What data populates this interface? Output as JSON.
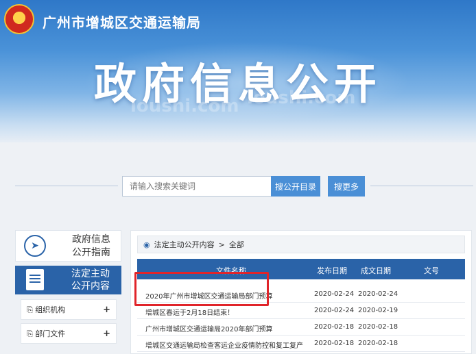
{
  "header": {
    "org_name": "广州市增城区交通运输局",
    "title": "政府信息公开",
    "watermark": "loushi.com"
  },
  "search": {
    "placeholder": "请输入搜索关键词",
    "catalog_button": "搜公开目录",
    "more_button": "搜更多"
  },
  "sidebar": {
    "guide_label_1": "政府信息",
    "guide_label_2": "公开指南",
    "active_label_1": "法定主动",
    "active_label_2": "公开内容",
    "items": [
      {
        "label": "组织机构",
        "plus": "+"
      },
      {
        "label": "部门文件",
        "plus": "+"
      }
    ]
  },
  "breadcrumb": {
    "section": "法定主动公开内容",
    "separator": ">",
    "current": "全部"
  },
  "table": {
    "columns": [
      "文件名称",
      "发布日期",
      "成文日期",
      "文号"
    ],
    "rows": [
      {
        "title": "2020年广州市增城区交通运输局部门预算",
        "published": "2020-02-24",
        "created": "2020-02-24"
      },
      {
        "title": "增城区春运于2月18日结束！",
        "published": "2020-02-24",
        "created": "2020-02-19"
      },
      {
        "title": "广州市增城区交通运输局2020年部门预算",
        "published": "2020-02-18",
        "created": "2020-02-18"
      },
      {
        "title": "增城区交通运输局检查客运企业疫情防控和复工复产",
        "published": "2020-02-18",
        "created": "2020-02-18"
      }
    ]
  },
  "colors": {
    "primary": "#2a63a8",
    "button": "#4a8fd6",
    "highlight": "#e0242a"
  }
}
